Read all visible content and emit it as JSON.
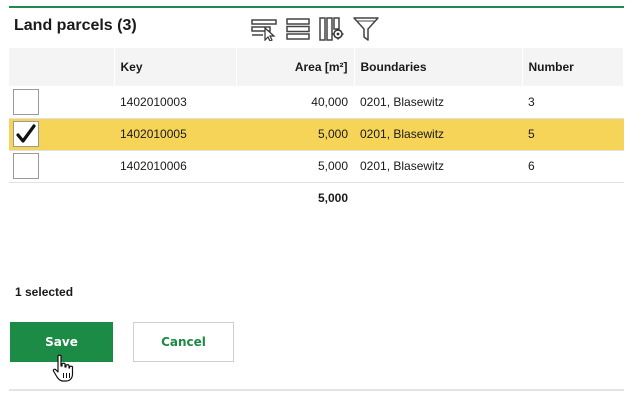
{
  "header": {
    "title": "Land parcels (3)",
    "toolbar": [
      "select-rows-icon",
      "list-icon",
      "column-settings-icon",
      "filter-icon"
    ]
  },
  "table": {
    "columns": {
      "key": "Key",
      "area": "Area [m²]",
      "boundaries": "Boundaries",
      "number": "Number"
    },
    "rows": [
      {
        "checked": false,
        "key": "1402010003",
        "area": "40,000",
        "boundaries": "0201, Blasewitz",
        "number": "3"
      },
      {
        "checked": true,
        "key": "1402010005",
        "area": "5,000",
        "boundaries": "0201, Blasewitz",
        "number": "5"
      },
      {
        "checked": false,
        "key": "1402010006",
        "area": "5,000",
        "boundaries": "0201, Blasewitz",
        "number": "6"
      }
    ],
    "area_total": "5,000"
  },
  "footer": {
    "selected_label": "1 selected",
    "save_label": "Save",
    "cancel_label": "Cancel"
  },
  "colors": {
    "accent_green": "#1b8b46",
    "selected_row": "#f5d458",
    "header_bg": "#f4f4f4"
  }
}
